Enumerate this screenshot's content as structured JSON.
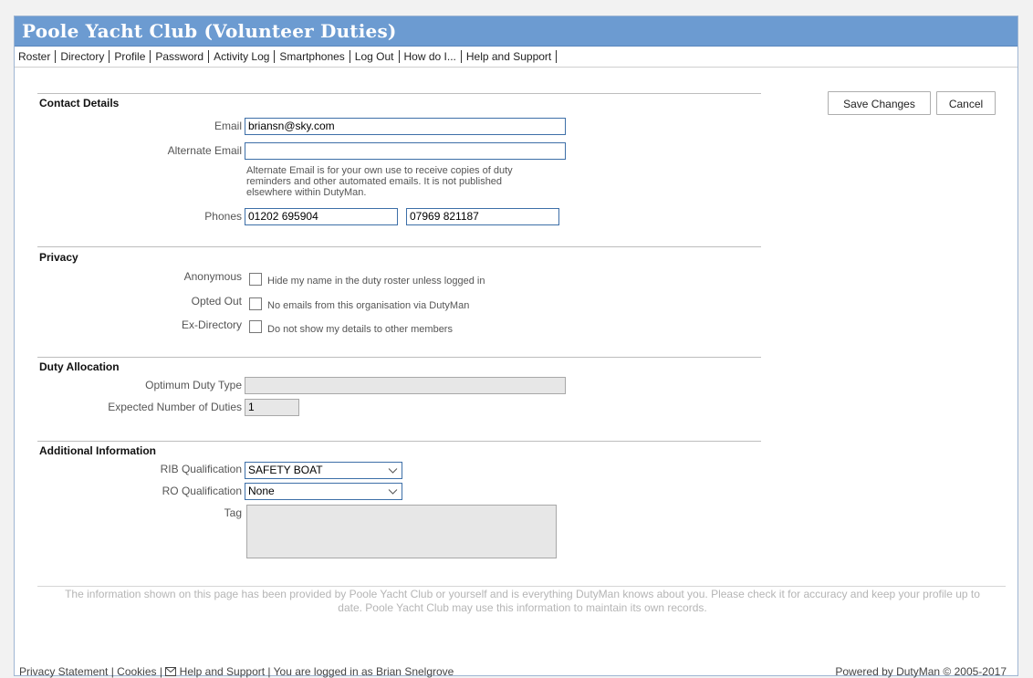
{
  "header": {
    "title": "Poole Yacht Club (Volunteer Duties)"
  },
  "nav": {
    "items": [
      "Roster",
      "Directory",
      "Profile",
      "Password",
      "Activity Log",
      "Smartphones",
      "Log Out",
      "How do I...",
      "Help and Support"
    ]
  },
  "buttons": {
    "save": "Save Changes",
    "cancel": "Cancel"
  },
  "contact": {
    "title": "Contact Details",
    "email_label": "Email",
    "email_value": "briansn@sky.com",
    "alt_email_label": "Alternate Email",
    "alt_email_value": "",
    "alt_email_help_1": "Alternate Email is for your own use to receive copies of duty",
    "alt_email_help_2": "reminders and other automated emails. It is not published",
    "alt_email_help_3": "elsewhere within DutyMan.",
    "phones_label": "Phones",
    "phone1": "01202 695904",
    "phone2": "07969 821187"
  },
  "privacy": {
    "title": "Privacy",
    "anonymous_label": "Anonymous",
    "anonymous_text": "Hide my name in the duty roster unless logged in",
    "optedout_label": "Opted Out",
    "optedout_text": "No emails from this organisation via DutyMan",
    "exdirectory_label": "Ex-Directory",
    "exdirectory_text": "Do not show my details to other members"
  },
  "duty": {
    "title": "Duty Allocation",
    "optimum_label": "Optimum Duty Type",
    "optimum_value": "",
    "expected_label": "Expected Number of Duties",
    "expected_value": "1"
  },
  "additional": {
    "title": "Additional Information",
    "rib_label": "RIB Qualification",
    "rib_value": "SAFETY BOAT",
    "ro_label": "RO Qualification",
    "ro_value": "None",
    "tag_label": "Tag"
  },
  "footnote": {
    "line1": "The information shown on this page has been provided by Poole Yacht Club or yourself and is everything DutyMan knows about you. Please check it for accuracy and keep your profile up to",
    "line2": "date.  Poole Yacht Club may use this information to maintain its own records."
  },
  "footer": {
    "privacy": "Privacy Statement",
    "cookies": "Cookies",
    "help": "Help and Support",
    "logged_in": "You are logged in as Brian Snelgrove",
    "powered": "Powered by DutyMan © 2005-2017"
  }
}
